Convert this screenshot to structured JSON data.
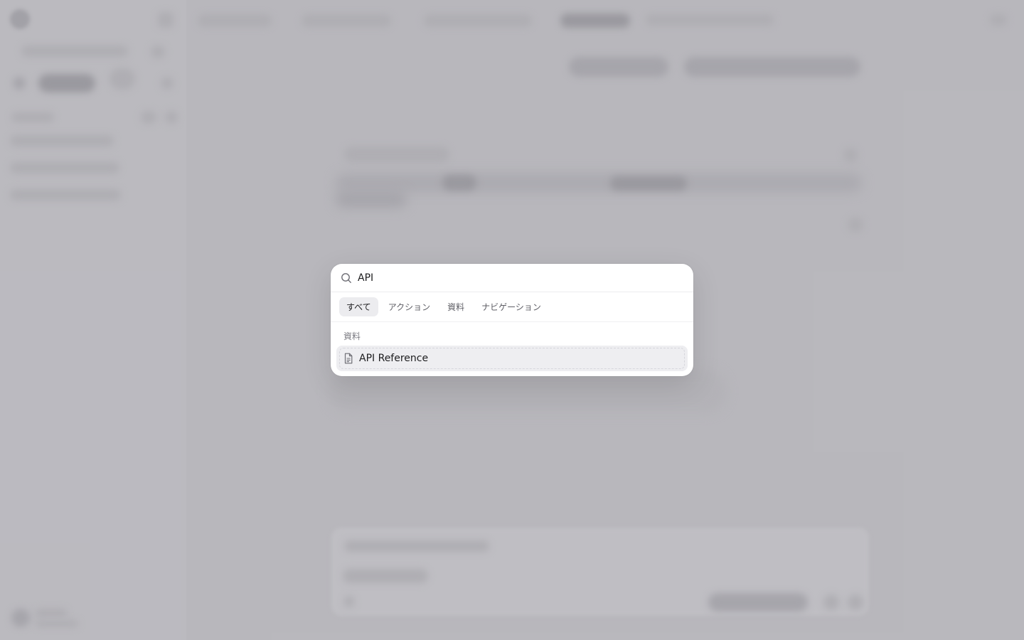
{
  "search": {
    "query": "API"
  },
  "tabs": [
    {
      "label": "すべて",
      "active": true
    },
    {
      "label": "アクション",
      "active": false
    },
    {
      "label": "資料",
      "active": false
    },
    {
      "label": "ナビゲーション",
      "active": false
    }
  ],
  "results": {
    "section_label": "資料",
    "items": [
      {
        "label": "API Reference",
        "icon": "document-icon",
        "selected": true
      }
    ]
  },
  "colors": {
    "scrim": "#bdbcc1",
    "palette_bg": "#ffffff",
    "tab_active_bg": "#ececef",
    "result_selected_bg": "#eeeef1"
  }
}
